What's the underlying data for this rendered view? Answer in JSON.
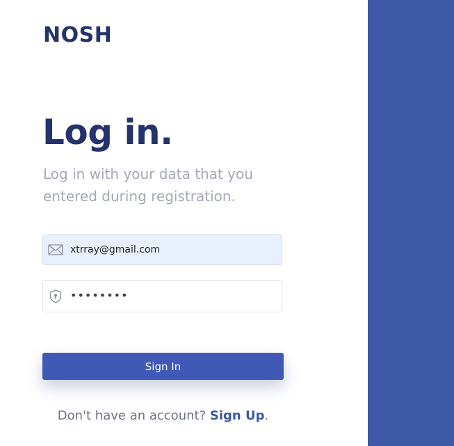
{
  "brand": {
    "name": "NOSH"
  },
  "login": {
    "heading": "Log in.",
    "subtitle": "Log in with your data that you entered during registration."
  },
  "form": {
    "email_value": "xtrray@gmail.com",
    "password_masked": "••••••••",
    "signin_label": "Sign In"
  },
  "footer": {
    "prompt": "Don't have an account?",
    "signup_label": "Sign Up",
    "trailing": "."
  },
  "icons": {
    "email": "envelope-icon",
    "password": "shield-lock-icon"
  },
  "colors": {
    "brand_dark": "#24336b",
    "accent": "#3d58a6",
    "button": "#4159b6",
    "muted_text": "#a4a9b5",
    "email_field_bg": "#e8f0fe"
  }
}
